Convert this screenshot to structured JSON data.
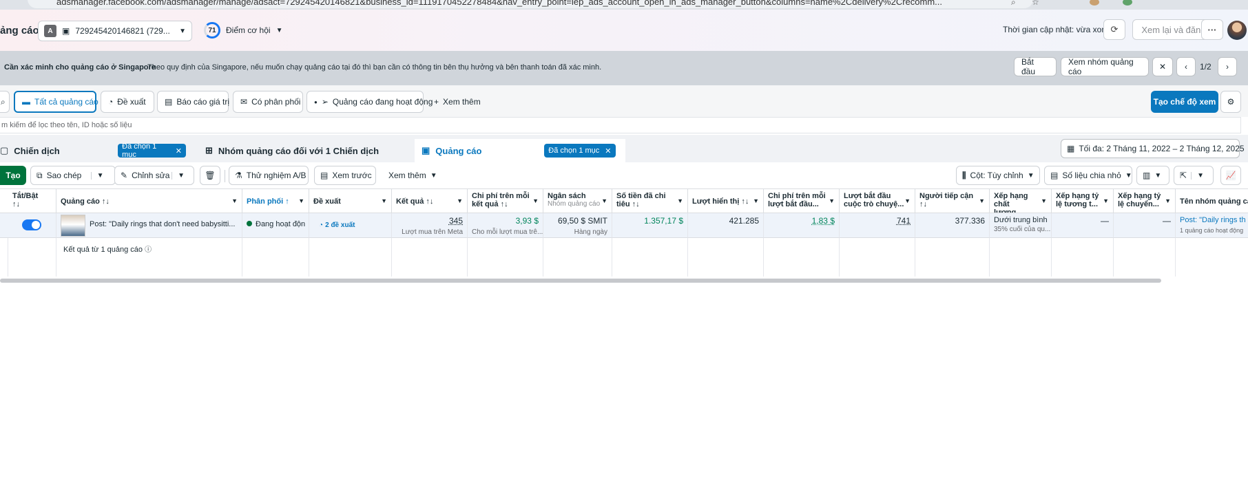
{
  "browser": {
    "url": "adsmanager.facebook.com/adsmanager/manage/adsact=729245420146821&business_id=1119170452278484&nav_entry_point=lep_ads_account_open_in_ads_manager_button&columns=name%2Cdelivery%2Crecomm..."
  },
  "header": {
    "page_title": "ảng cáo",
    "account_badge": "A",
    "account_id": "729245420146821 (729...",
    "score_value": "71",
    "score_label": "Điểm cơ hội",
    "updated_text": "Thời gian cập nhật: vừa xong",
    "review_publish": "Xem lại và đăng",
    "more": "···"
  },
  "notice": {
    "title": "Cần xác minh cho quảng cáo ở Singapore",
    "message": "Theo quy định của Singapore, nếu muốn chạy quảng cáo tại đó thì bạn cần có thông tin bên thụ hưởng và bên thanh toán đã xác minh.",
    "start_button": "Bắt đầu",
    "view_adsets_button": "Xem nhóm quảng cáo",
    "pager": "1/2"
  },
  "filter_tabs": {
    "all_ads": "Tất cả quảng cáo",
    "recommendations": "Đề xuất",
    "value_reports": "Báo cáo giá trị",
    "has_delivery": "Có phân phối",
    "active_ads": "Quảng cáo đang hoạt động",
    "see_more": "Xem thêm",
    "create_view": "Tạo chế độ xem"
  },
  "search": {
    "placeholder": "m kiếm để lọc theo tên, ID hoặc số liệu"
  },
  "levels": {
    "campaigns": "Chiến dịch",
    "campaigns_chip": "Đã chọn 1 mục",
    "adsets": "Nhóm quảng cáo đối với 1 Chiến dịch",
    "ads": "Quảng cáo",
    "ads_chip": "Đã chọn 1 mục",
    "date_range": "Tối đa: 2 Tháng 11, 2022 – 2 Tháng 12, 2025"
  },
  "toolbar": {
    "create": "Tạo",
    "duplicate": "Sao chép",
    "edit": "Chỉnh sửa",
    "ab_test": "Thử nghiệm A/B",
    "preview": "Xem trước",
    "see_more": "Xem thêm",
    "columns": "Cột: Tùy chỉnh",
    "breakdown": "Số liệu chia nhỏ"
  },
  "table": {
    "headers": {
      "toggle": "Tắt/Bật",
      "toggle_sort": "↑↓",
      "ad": "Quảng cáo ↑↓",
      "delivery": "Phân phối ↑",
      "recommendations": "Đề xuất",
      "results": "Kết quả ↑↓",
      "cost_per_result": "Chi phí trên mỗi kết quả ↑↓",
      "budget": "Ngân sách",
      "budget_sub": "Nhóm quảng cáo",
      "amount_spent": "Số tiền đã chi tiêu ↑↓",
      "impressions": "Lượt hiển thị ↑↓",
      "cost_per_start": "Chi phí trên mỗi lượt bắt đầu...",
      "conversation_starts": "Lượt bắt đầu cuộc trò chuyệ...",
      "reach": "Người tiếp cận ↑↓",
      "quality_ranking": "Xếp hạng chất lượng...",
      "engagement_ranking": "Xếp hạng tỷ lệ tương t...",
      "conversion_ranking": "Xếp hạng tỷ lệ chuyển...",
      "adset_name": "Tên nhóm quảng cá"
    },
    "row": {
      "ad_name": "Post: \"Daily rings that don't need babysitti...",
      "delivery": "Đang hoạt độn",
      "recommendations": "2 đề xuất",
      "results": "345",
      "results_sub": "Lượt mua trên Meta",
      "cost_per_result": "3,93 $",
      "cost_per_result_sub": "Cho mỗi lượt mua trê...",
      "budget": "69,50 $ SMIT",
      "budget_sub": "Hàng ngày",
      "amount_spent": "1.357,17 $",
      "impressions": "421.285",
      "cost_per_start": "1,83 $",
      "conversation_starts": "741",
      "reach": "377.336",
      "quality_ranking": "Dưới trung bình",
      "quality_ranking_sub": "35% cuối của qu...",
      "engagement_ranking": "—",
      "conversion_ranking": "—",
      "adset_name": "Post: \"Daily rings th",
      "adset_sub": "1 quảng cáo hoạt động"
    },
    "footer": "Kết quả từ 1 quảng cáo"
  }
}
